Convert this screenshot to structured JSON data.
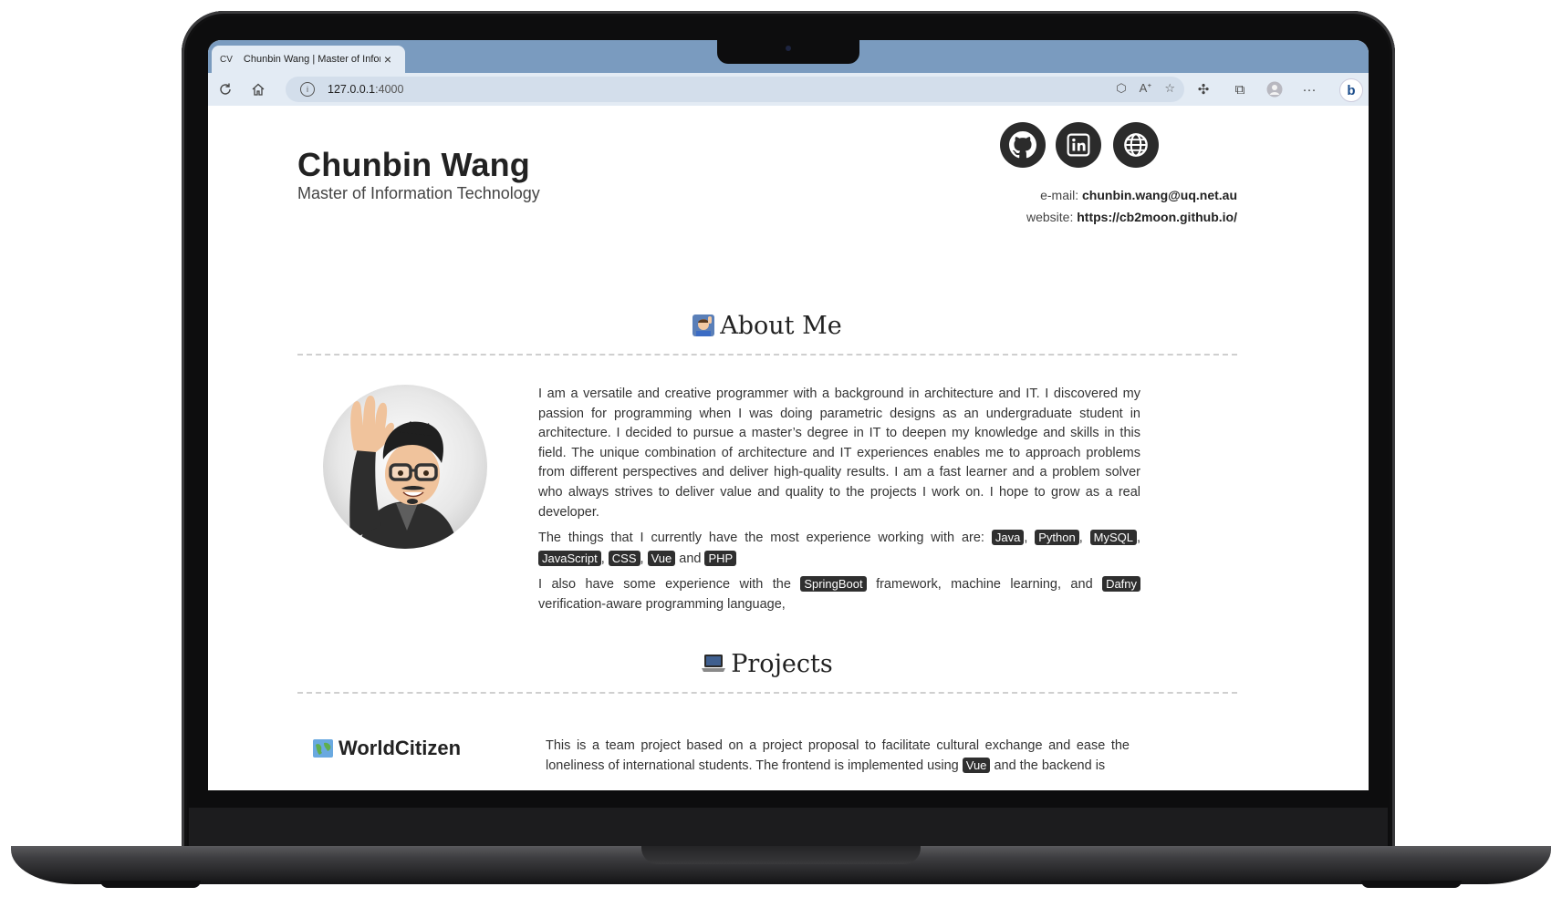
{
  "browser": {
    "tab": {
      "prefix": "CV",
      "title": "Chunbin Wang | Master of Information Technology",
      "close": "×"
    },
    "url": {
      "host": "127.0.0.1",
      "port": ":4000"
    }
  },
  "header": {
    "name": "Chunbin Wang",
    "subtitle": "Master of Information Technology",
    "social": [
      "github-icon",
      "linkedin-icon",
      "globe-icon"
    ],
    "email_label": "e-mail:",
    "email": "chunbin.wang@uq.net.au",
    "website_label": "website:",
    "website": "https://cb2moon.github.io/"
  },
  "about": {
    "title": "About Me",
    "p1": "I am a versatile and creative programmer with a background in architecture and IT. I discovered my passion for programming when I was doing parametric designs as an undergraduate student in architecture. I decided to pursue a master’s degree in IT to deepen my knowledge and skills in this field. The unique combination of architecture and IT experiences enables me to approach problems from different perspectives and deliver high-quality results. I am a fast learner and a problem solver who always strives to deliver value and quality to the projects I work on. I hope to grow as a real developer.",
    "p2_intro": "The things that I currently have the most experience working with are:",
    "skills": [
      "Java",
      "Python",
      "MySQL",
      "JavaScript",
      "CSS",
      "Vue",
      "PHP"
    ],
    "p2_and": "and",
    "p3_a": "I also have some experience with the",
    "p3_tag1": "SpringBoot",
    "p3_b": "framework, machine learning, and",
    "p3_tag2": "Dafny",
    "p3_c": "verification-aware programming language,"
  },
  "projects": {
    "title": "Projects",
    "first": {
      "name": "WorldCitizen",
      "desc": "This is a team project based on a project proposal to facilitate cultural exchange and ease the loneliness of international students. The frontend is implemented using",
      "tag": "Vue",
      "desc_tail": "and the backend is"
    }
  },
  "colors": {
    "tab_bar": "#7a9bbf",
    "toolbar": "#e3ebf4",
    "tag_bg": "#2f2f2f"
  }
}
